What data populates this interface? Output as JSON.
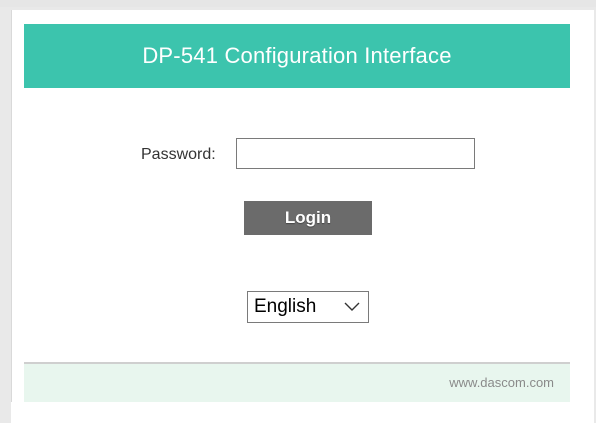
{
  "header": {
    "title": "DP-541 Configuration Interface"
  },
  "login_form": {
    "password_label": "Password:",
    "password_value": "",
    "login_button_label": "Login"
  },
  "language": {
    "selected": "English"
  },
  "footer": {
    "link_text": "www.dascom.com"
  },
  "colors": {
    "header_background": "#3cc4ad",
    "header_text": "#ffffff",
    "button_background": "#6b6b6b",
    "footer_background": "#e8f6ee",
    "page_background": "#e9e9e9"
  },
  "icons": {
    "language_dropdown": "chevron-down-icon"
  }
}
